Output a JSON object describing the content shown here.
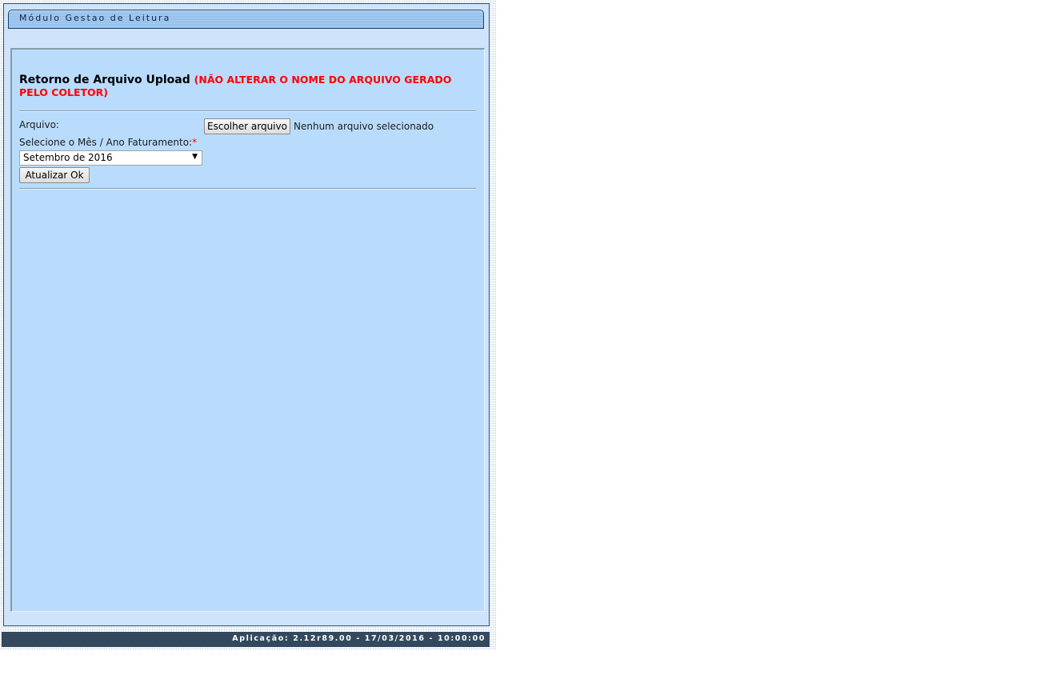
{
  "module": {
    "title": "Módulo Gestao de Leitura"
  },
  "form": {
    "heading": "Retorno de Arquivo Upload",
    "heading_warning": "(NÃO ALTERAR O NOME DO ARQUIVO GERADO PELO COLETOR)",
    "file_label": "Arquivo:",
    "file_button_label": "Escolher arquivo",
    "file_status": "Nenhum arquivo selecionado",
    "period_label": "Selecione o Mês / Ano Faturamento:",
    "required_marker": "*",
    "period_selected": "Setembro de 2016",
    "submit_label": "Atualizar Ok"
  },
  "footer": {
    "app_info": "Aplicação: 2.12r89.00 - 17/03/2016 - 10:00:00"
  },
  "colors": {
    "panel_background": "#b9dcfd",
    "frame_background": "#cfe4fb",
    "warning_text": "#ff0000",
    "footer_background": "#34495e"
  },
  "icons": {
    "select_arrow": "chevron-down-icon"
  }
}
